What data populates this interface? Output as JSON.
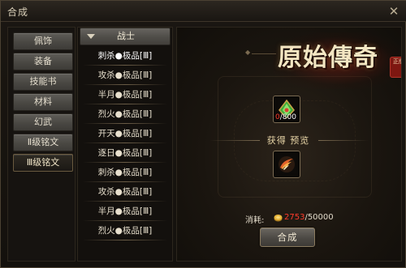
{
  "window": {
    "title": "合成",
    "close_label": "✕"
  },
  "tabs": [
    {
      "label": "佩饰",
      "active": false
    },
    {
      "label": "装备",
      "active": false
    },
    {
      "label": "技能书",
      "active": false
    },
    {
      "label": "材料",
      "active": false
    },
    {
      "label": "幻武",
      "active": false
    },
    {
      "label": "Ⅱ级铭文",
      "active": false
    },
    {
      "label": "Ⅲ级铭文",
      "active": true
    }
  ],
  "list": {
    "header": "战士",
    "items": [
      {
        "label": "刺杀●极品[Ⅲ]",
        "selected": true
      },
      {
        "label": "攻杀●极品[Ⅲ]",
        "selected": false
      },
      {
        "label": "半月●极品[Ⅲ]",
        "selected": false
      },
      {
        "label": "烈火●极品[Ⅲ]",
        "selected": false
      },
      {
        "label": "开天●极品[Ⅲ]",
        "selected": false
      },
      {
        "label": "逐日●极品[Ⅲ]",
        "selected": false
      },
      {
        "label": "刺杀●极品[Ⅲ]",
        "selected": false
      },
      {
        "label": "攻杀●极品[Ⅲ]",
        "selected": false
      },
      {
        "label": "半月●极品[Ⅲ]",
        "selected": false
      },
      {
        "label": "烈火●极品[Ⅲ]",
        "selected": false
      }
    ]
  },
  "panel": {
    "logo_text": "原始傳奇",
    "logo_seal": "正版",
    "material": {
      "icon": "green-crystal-icon",
      "have": "0",
      "need": "/800"
    },
    "preview_label": "获得 预览",
    "result": {
      "icon": "flame-wing-icon"
    },
    "cost_label": "消耗:",
    "cost_icon": "gold-coin-icon",
    "cost_have": "2753",
    "cost_need": "/50000",
    "craft_button": "合成"
  },
  "colors": {
    "insufficient": "#ff3b2c",
    "accent_gold": "#e9d6a8"
  }
}
